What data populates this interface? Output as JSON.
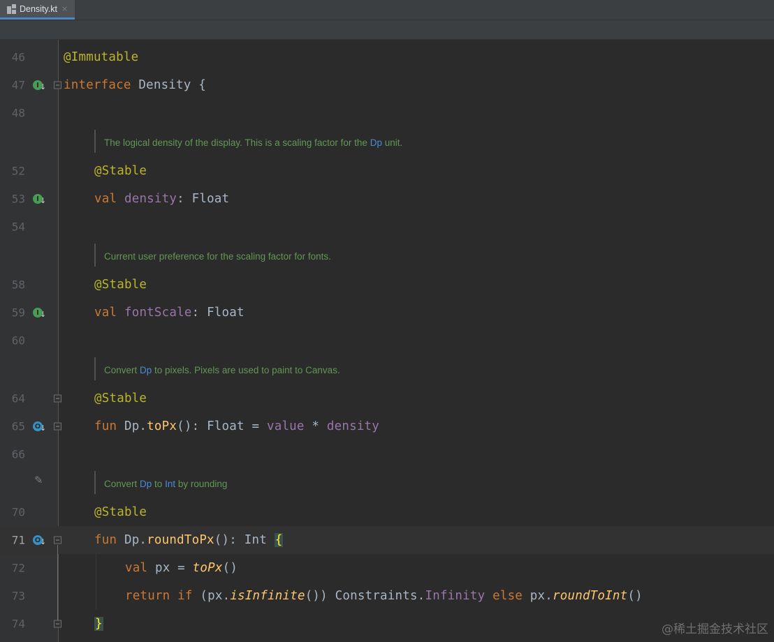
{
  "tab": {
    "file_name": "Density.kt",
    "close_symbol": "×",
    "icon": "kotlin-file-icon"
  },
  "lines": {
    "l46": {
      "num": "46",
      "code": "@Immutable"
    },
    "l47": {
      "num": "47",
      "kw": "interface",
      "rest": " Density {"
    },
    "l48": {
      "num": "48"
    },
    "l52": {
      "num": "52",
      "code": "@Stable"
    },
    "l53": {
      "num": "53",
      "kw": "val",
      "prop": "density",
      "rest": ": Float"
    },
    "l54": {
      "num": "54"
    },
    "l58": {
      "num": "58",
      "code": "@Stable"
    },
    "l59": {
      "num": "59",
      "kw": "val",
      "prop": "fontScale",
      "rest": ": Float"
    },
    "l60": {
      "num": "60"
    },
    "l64": {
      "num": "64",
      "code": "@Stable"
    },
    "l65": {
      "num": "65",
      "kw": "fun",
      "recv": " Dp.",
      "fn": "toPx",
      "mid": "(): Float = ",
      "prop1": "value",
      "op": " * ",
      "prop2": "density"
    },
    "l66": {
      "num": "66"
    },
    "l70": {
      "num": "70",
      "code": "@Stable"
    },
    "l71": {
      "num": "71",
      "kw": "fun",
      "recv": " Dp.",
      "fn": "roundToPx",
      "mid": "(): Int ",
      "brace": "{"
    },
    "l72": {
      "num": "72",
      "kw": "val",
      "mid": " px = ",
      "fn": "toPx",
      "rest": "()"
    },
    "l73": {
      "num": "73",
      "kw1": "return",
      "kw2": " if",
      "p1": " (px.",
      "fn1": "isInfinite",
      "p2": "()) Constraints.",
      "prop": "Infinity",
      "kw3": " else",
      "p3": " px.",
      "fn2": "roundToInt",
      "p4": "()"
    },
    "l74": {
      "num": "74",
      "brace": "}"
    }
  },
  "docs": {
    "d1": {
      "pre": "The logical density of the display. This is a scaling factor for the ",
      "link": "Dp",
      "post": " unit."
    },
    "d2": {
      "text": "Current user preference for the scaling factor for fonts."
    },
    "d3": {
      "pre": "Convert ",
      "link": "Dp",
      "post": " to pixels. Pixels are used to paint to Canvas."
    },
    "d4": {
      "pre": "Convert ",
      "link1": "Dp",
      "mid": " to ",
      "link2": "Int",
      "post": " by rounding"
    }
  },
  "gutter_icons": {
    "implemented": "I",
    "overrides": "O",
    "arrow": "↓",
    "pencil": "✎"
  },
  "watermark": "@稀土掘金技术社区",
  "colors": {
    "keyword": "#cc7832",
    "annotation": "#bbb529",
    "property": "#9876aa",
    "function": "#ffc66d",
    "doc_comment": "#629755",
    "doc_link": "#4b8bd6",
    "background": "#2b2b2b"
  }
}
